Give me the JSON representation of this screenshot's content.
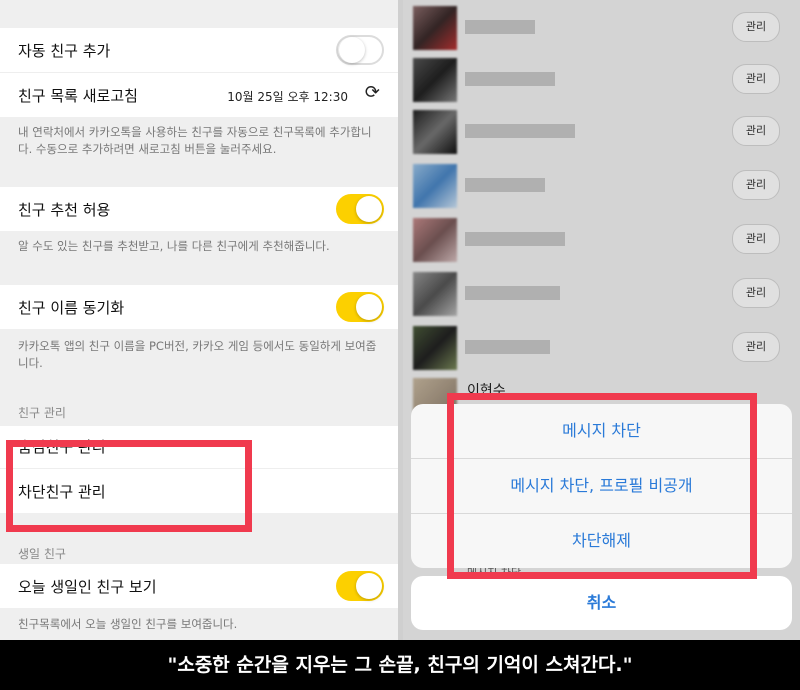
{
  "settings": {
    "auto_add": {
      "label": "자동 친구 추가",
      "toggle": false
    },
    "refresh": {
      "label": "친구 목록 새로고침",
      "timestamp": "10월 25일 오후 12:30"
    },
    "refresh_desc": "내 연락처에서 카카오톡을 사용하는 친구를 자동으로 친구목록에 추가합니다. 수동으로 추가하려면 새로고침 버튼을 눌러주세요.",
    "recommend": {
      "label": "친구 추천 허용",
      "toggle": true
    },
    "recommend_desc": "알 수도 있는 친구를 추천받고, 나를 다른 친구에게 추천해줍니다.",
    "name_sync": {
      "label": "친구 이름 동기화",
      "toggle": true
    },
    "name_sync_desc": "카카오톡 앱의 친구 이름을 PC버전, 카카오 게임 등에서도 동일하게 보여줍니다.",
    "manage_section": "친구 관리",
    "hidden_manage": "숨김친구 관리",
    "blocked_manage": "차단친구 관리",
    "birthday_section": "생일 친구",
    "birthday_view": {
      "label": "오늘 생일인 친구 보기",
      "toggle": true
    },
    "birthday_desc": "친구목록에서 오늘 생일인 친구를 보여줍니다."
  },
  "friend_list": {
    "manage_label": "관리",
    "partial_name": "이현수",
    "partial_sub": "메시지 차단"
  },
  "action_sheet": {
    "items": [
      "메시지 차단",
      "메시지 차단, 프로필 비공개",
      "차단해제"
    ],
    "cancel": "취소"
  },
  "caption": "\"소중한 순간을 지우는 그 손끝, 친구의 기억이 스쳐간다.\"",
  "colors": {
    "accent_yellow": "#fcd000",
    "ios_blue": "#2a7ad8",
    "highlight_red": "#f03a4e"
  }
}
